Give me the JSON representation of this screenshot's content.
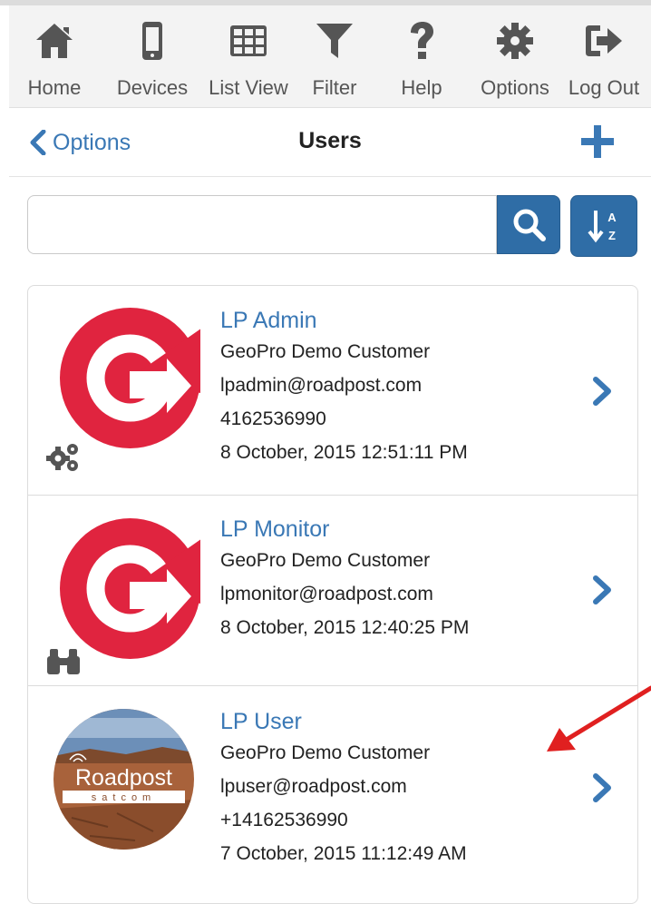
{
  "toolbar": {
    "items": [
      {
        "label": "Home",
        "icon": "home-icon"
      },
      {
        "label": "Devices",
        "icon": "mobile-device-icon"
      },
      {
        "label": "List View",
        "icon": "table-grid-icon"
      },
      {
        "label": "Filter",
        "icon": "filter-funnel-icon"
      },
      {
        "label": "Help",
        "icon": "question-mark-icon"
      },
      {
        "label": "Options",
        "icon": "gear-icon"
      },
      {
        "label": "Log Out",
        "icon": "sign-out-icon"
      }
    ]
  },
  "navbar": {
    "back_label": "Options",
    "title": "Users",
    "add_icon": "plus-icon"
  },
  "search": {
    "value": "",
    "placeholder": "",
    "search_icon": "search-icon",
    "sort_icon": "sort-alpha-icon"
  },
  "users": [
    {
      "name": "LP Admin",
      "customer": "GeoPro Demo Customer",
      "email": "lpadmin@roadpost.com",
      "phone": "4162536990",
      "timestamp": "8 October, 2015 12:51:11 PM",
      "avatar": "geopro-logo",
      "role_icon": "gears-icon"
    },
    {
      "name": "LP Monitor",
      "customer": "GeoPro Demo Customer",
      "email": "lpmonitor@roadpost.com",
      "phone": "",
      "timestamp": "8 October, 2015 12:40:25 PM",
      "avatar": "geopro-logo",
      "role_icon": "binoculars-icon"
    },
    {
      "name": "LP User",
      "customer": "GeoPro Demo Customer",
      "email": "lpuser@roadpost.com",
      "phone": "+14162536990",
      "timestamp": "7 October, 2015 11:12:49 AM",
      "avatar": "roadpost-satcom-logo",
      "avatar_text": "Roadpost",
      "avatar_subtext": "satcom",
      "role_icon": ""
    }
  ],
  "colors": {
    "accent": "#3a78b5",
    "button": "#2f6da6",
    "logo_red": "#e0243f",
    "annotation_arrow": "#e02020"
  }
}
